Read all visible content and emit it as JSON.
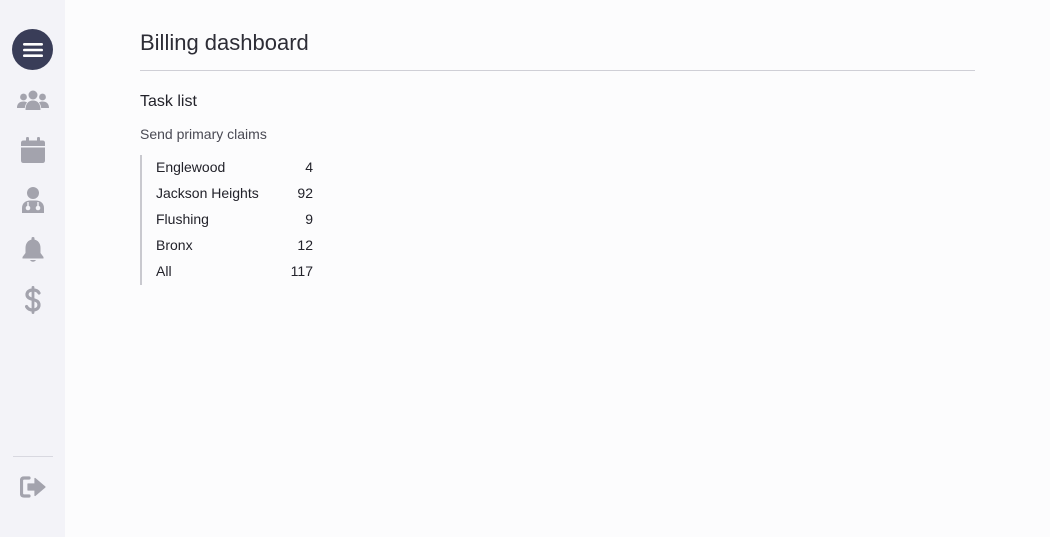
{
  "sidebar": {
    "items": [
      {
        "name": "menu-button",
        "icon": "hamburger-menu-icon"
      },
      {
        "name": "patients-nav",
        "icon": "users-group-icon"
      },
      {
        "name": "calendar-nav",
        "icon": "calendar-icon"
      },
      {
        "name": "doctor-nav",
        "icon": "user-doctor-icon"
      },
      {
        "name": "notifications-nav",
        "icon": "bell-icon"
      },
      {
        "name": "billing-nav",
        "icon": "dollar-icon"
      },
      {
        "name": "logout-nav",
        "icon": "sign-out-icon"
      }
    ],
    "colors": {
      "background": "#f3f3f8",
      "icon": "#a3a3ad",
      "active": "#393d58"
    }
  },
  "page": {
    "title": "Billing dashboard"
  },
  "task_list": {
    "heading": "Task list",
    "group_label": "Send primary claims",
    "rows": [
      {
        "location": "Englewood",
        "count": "4"
      },
      {
        "location": "Jackson Heights",
        "count": "92"
      },
      {
        "location": "Flushing",
        "count": "9"
      },
      {
        "location": "Bronx",
        "count": "12"
      },
      {
        "location": "All",
        "count": "117"
      }
    ]
  }
}
